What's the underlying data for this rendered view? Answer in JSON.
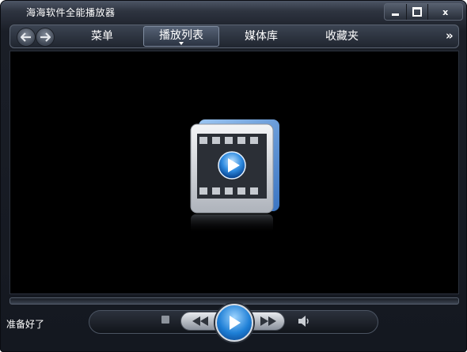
{
  "window": {
    "title": "海海软件全能播放器"
  },
  "window_buttons": {
    "minimize": "minimize-icon",
    "maximize": "maximize-icon",
    "close_label": "x"
  },
  "nav": {
    "back_icon": "back-arrow-icon",
    "forward_icon": "forward-arrow-icon",
    "tabs": [
      {
        "label": "菜单"
      },
      {
        "label": "播放列表",
        "active": true
      },
      {
        "label": "媒体库"
      },
      {
        "label": "收藏夹"
      }
    ],
    "more_label": "»"
  },
  "video": {
    "placeholder_icon": "film-play-icon"
  },
  "status": {
    "text": "准备好了"
  },
  "controls": {
    "stop_icon": "stop-icon",
    "rewind_icon": "rewind-icon",
    "play_icon": "play-icon",
    "forward_icon": "fast-forward-icon",
    "volume_icon": "volume-icon"
  },
  "colors": {
    "accent": "#1e7fd6",
    "chrome_dark": "#1a1e27",
    "video_bg": "#000000"
  }
}
